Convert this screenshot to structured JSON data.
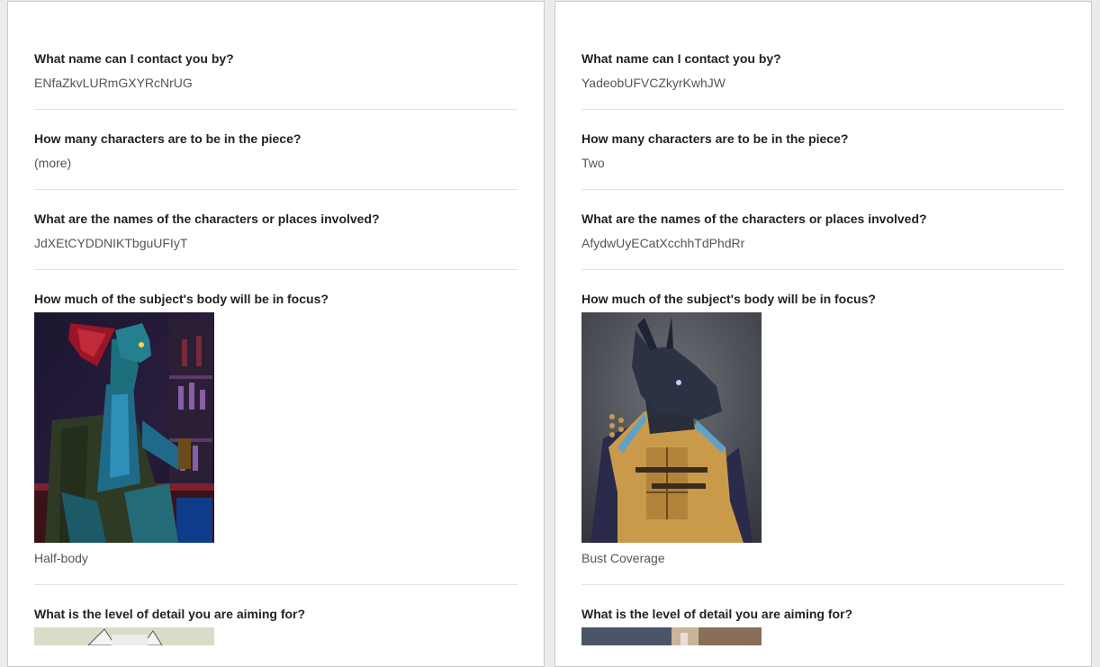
{
  "entries": [
    {
      "contact_q": "What name can I contact you by?",
      "contact_a": "ENfaZkvLURmGXYRcNrUG",
      "chars_q": "How many characters are to be in the piece?",
      "chars_a": "(more)",
      "names_q": "What are the names of the characters or places involved?",
      "names_a": "JdXEtCYDDNIKTbguUFIyT",
      "focus_q": "How much of the subject's body will be in focus?",
      "focus_a": "Half-body",
      "detail_q": "What is the level of detail you are aiming for?"
    },
    {
      "contact_q": "What name can I contact you by?",
      "contact_a": "YadeobUFVCZkyrKwhJW",
      "chars_q": "How many characters are to be in the piece?",
      "chars_a": "Two",
      "names_q": "What are the names of the characters or places involved?",
      "names_a": "AfydwUyECatXcchhTdPhdRr",
      "focus_q": "How much of the subject's body will be in focus?",
      "focus_a": "Bust Coverage",
      "detail_q": "What is the level of detail you are aiming for?"
    }
  ]
}
